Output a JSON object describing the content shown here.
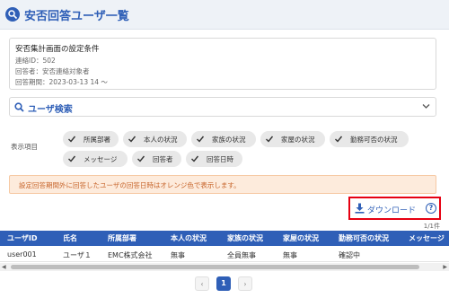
{
  "header": {
    "title": "安否回答ユーザ一覧",
    "icon": "search-person-icon"
  },
  "conditions": {
    "title": "安否集計画面の設定条件",
    "lines": [
      "連絡ID：502",
      "回答者：安否連絡対象者",
      "回答期間：2023-03-13 14 ～"
    ]
  },
  "search": {
    "label": "ユーザ検索",
    "icon": "search-icon"
  },
  "display_items": {
    "label": "表示項目",
    "chips": [
      "所属部署",
      "本人の状況",
      "家族の状況",
      "家屋の状況",
      "勤務可否の状況",
      "メッセージ",
      "回答者",
      "回答日時"
    ]
  },
  "notice": "設定回答期間外に回答したユーザの回答日時はオレンジ色で表示します。",
  "download": {
    "label": "ダウンロード",
    "help": "?"
  },
  "count": "1/1件",
  "table": {
    "columns": [
      "ユーザID",
      "氏名",
      "所属部署",
      "本人の状況",
      "家族の状況",
      "家屋の状況",
      "勤務可否の状況",
      "メッセージ"
    ],
    "rows": [
      [
        "user001",
        "ユーザ１",
        "EMC株式会社",
        "無事",
        "全員無事",
        "無事",
        "確認中",
        ""
      ]
    ]
  },
  "pagination": {
    "prev": "‹",
    "current": "1",
    "next": "›"
  },
  "colors": {
    "accent": "#2f5fb7",
    "notice_text": "#c7642a",
    "notice_bg": "#fdebdc",
    "highlight_border": "#e60012"
  }
}
